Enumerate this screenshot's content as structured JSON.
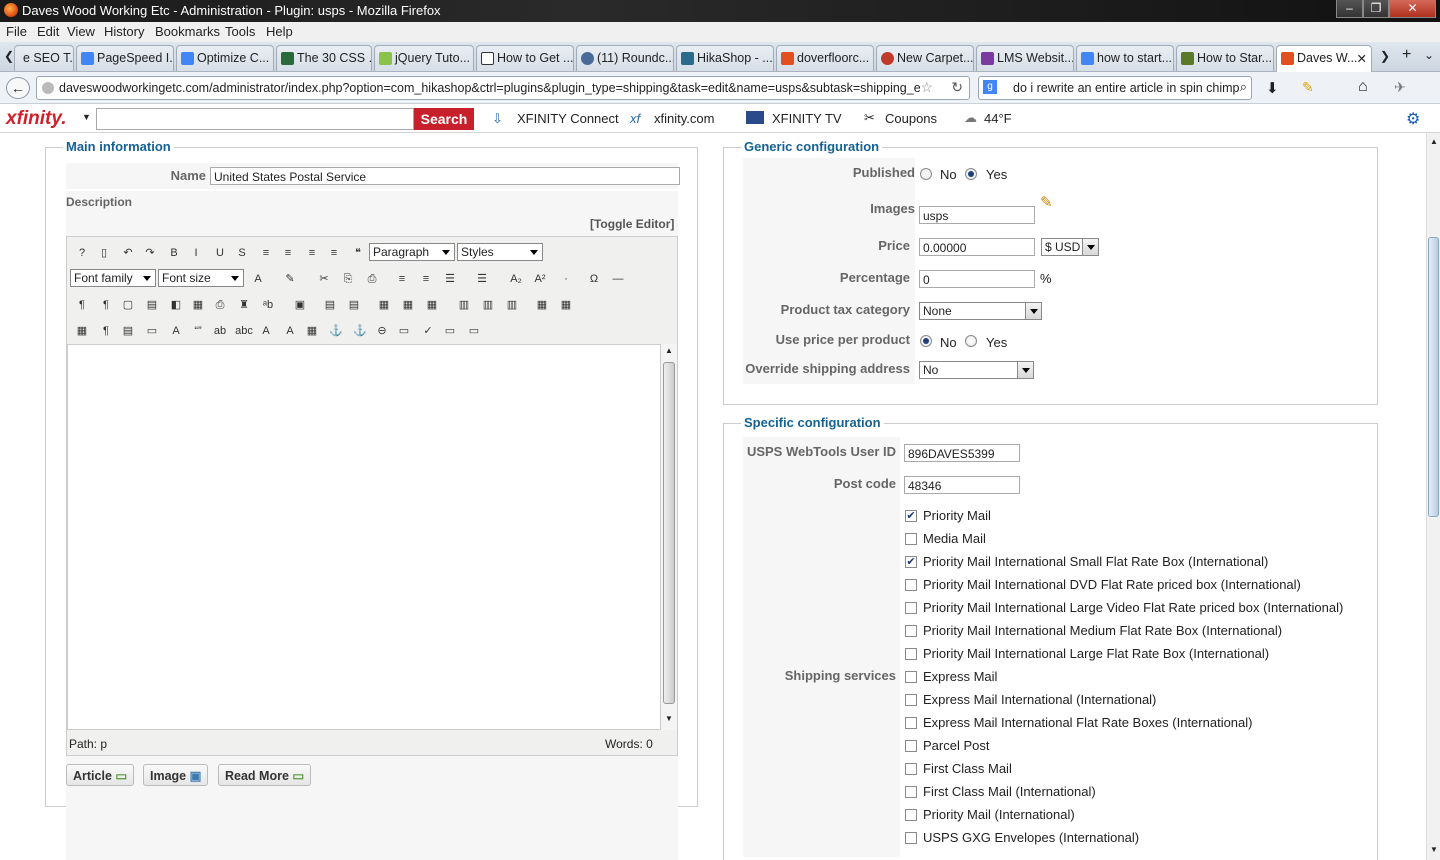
{
  "window": {
    "title": "Daves Wood Working Etc - Administration - Plugin: usps - Mozilla Firefox"
  },
  "menu": [
    "File",
    "Edit",
    "View",
    "History",
    "Bookmarks",
    "Tools",
    "Help"
  ],
  "tabs": [
    "e SEO T...",
    "PageSpeed I...",
    "Optimize C...",
    "The 30 CSS ...",
    "jQuery Tuto...",
    "How to Get ...",
    "(11) Roundc...",
    "HikaShop - ...",
    "doverfloorc...",
    "New Carpet...",
    "LMS Websit...",
    "how to start...",
    "How to Star...",
    "Daves W..."
  ],
  "nav": {
    "url": "daveswoodworkingetc.com/administrator/index.php?option=com_hikashop&ctrl=plugins&plugin_type=shipping&task=edit&name=usps&subtask=shipping_e",
    "search": "do i rewrite an entire article in spin chimp"
  },
  "xfinity": {
    "logo": "xfinity.",
    "search_btn": "Search",
    "connect": "XFINITY Connect",
    "site": "xfinity.com",
    "tv": "XFINITY TV",
    "coupons": "Coupons",
    "weather": "44°F"
  },
  "main": {
    "legend": "Main information",
    "name_label": "Name",
    "name_value": "United States Postal Service",
    "desc_label": "Description",
    "toggle": "[Toggle Editor]",
    "format": "Paragraph",
    "styles": "Styles",
    "font_family": "Font family",
    "font_size": "Font size",
    "path": "Path:  p",
    "words": "Words: 0",
    "btn_article": "Article",
    "btn_image": "Image",
    "btn_readmore": "Read More"
  },
  "generic": {
    "legend": "Generic configuration",
    "published": "Published",
    "no": "No",
    "yes": "Yes",
    "images": "Images",
    "images_value": "usps",
    "price": "Price",
    "price_value": "0.00000",
    "currency": "$ USD",
    "percentage": "Percentage",
    "percentage_value": "0",
    "percent_sign": "%",
    "tax": "Product tax category",
    "tax_value": "None",
    "use_price": "Use price per product",
    "override": "Override shipping address",
    "override_value": "No"
  },
  "specific": {
    "legend": "Specific configuration",
    "userid_label": "USPS WebTools User ID",
    "userid": "896DAVES5399",
    "postcode_label": "Post code",
    "postcode": "48346",
    "services_label": "Shipping services",
    "services": [
      {
        "label": "Priority Mail",
        "checked": true
      },
      {
        "label": "Media Mail",
        "checked": false
      },
      {
        "label": "Priority Mail International Small Flat Rate Box (International)",
        "checked": true
      },
      {
        "label": "Priority Mail International DVD Flat Rate priced box (International)",
        "checked": false
      },
      {
        "label": "Priority Mail International Large Video Flat Rate priced box (International)",
        "checked": false
      },
      {
        "label": "Priority Mail International Medium Flat Rate Box (International)",
        "checked": false
      },
      {
        "label": "Priority Mail International Large Flat Rate Box (International)",
        "checked": false
      },
      {
        "label": "Express Mail",
        "checked": false
      },
      {
        "label": "Express Mail International (International)",
        "checked": false
      },
      {
        "label": "Express Mail International Flat Rate Boxes (International)",
        "checked": false
      },
      {
        "label": "Parcel Post",
        "checked": false
      },
      {
        "label": "First Class Mail",
        "checked": false
      },
      {
        "label": "First Class Mail (International)",
        "checked": false
      },
      {
        "label": "Priority Mail (International)",
        "checked": false
      },
      {
        "label": "USPS GXG Envelopes (International)",
        "checked": false
      }
    ]
  }
}
